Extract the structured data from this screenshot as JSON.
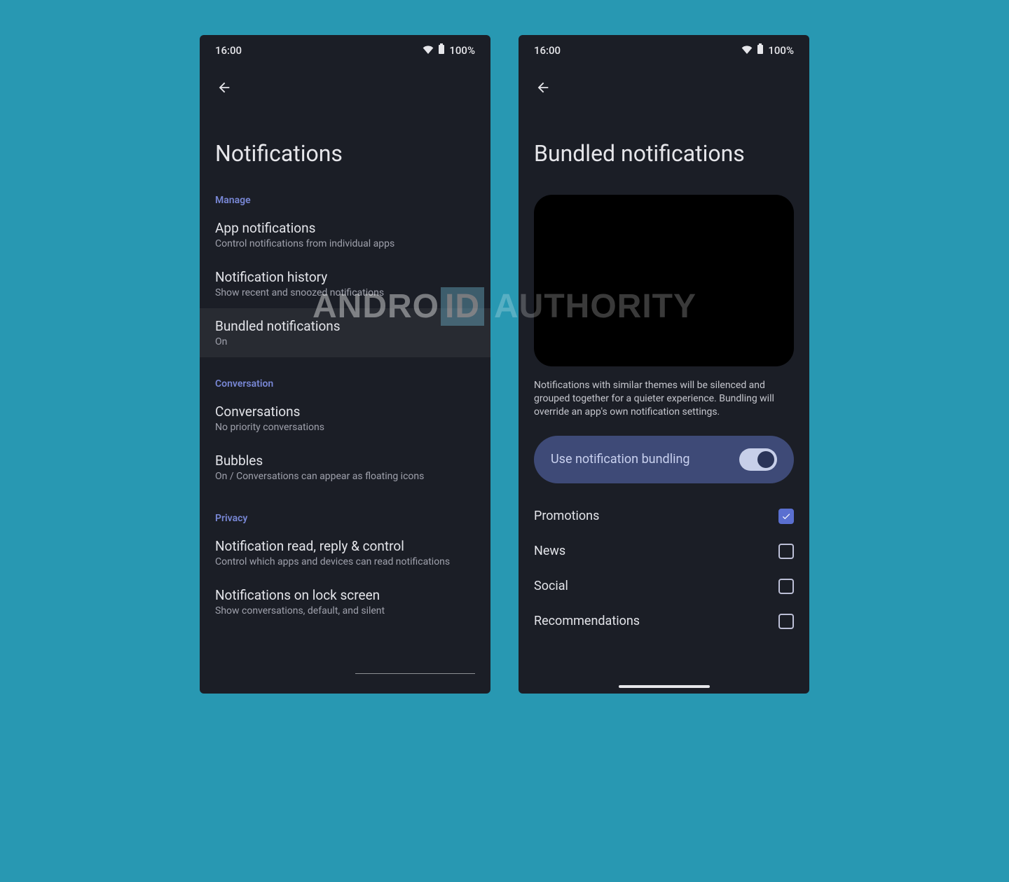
{
  "status": {
    "time": "16:00",
    "battery": "100%"
  },
  "watermark": {
    "a_pre": "ANDRO",
    "a_hl": "ID",
    "b": "AUTHORITY"
  },
  "left": {
    "title": "Notifications",
    "sections": {
      "manage": {
        "header": "Manage",
        "items": [
          {
            "title": "App notifications",
            "sub": "Control notifications from individual apps",
            "key": "app-notifications"
          },
          {
            "title": "Notification history",
            "sub": "Show recent and snoozed notifications",
            "key": "notification-history"
          },
          {
            "title": "Bundled notifications",
            "sub": "On",
            "key": "bundled-notifications",
            "selected": true
          }
        ]
      },
      "conversation": {
        "header": "Conversation",
        "items": [
          {
            "title": "Conversations",
            "sub": "No priority conversations",
            "key": "conversations"
          },
          {
            "title": "Bubbles",
            "sub": "On / Conversations can appear as floating icons",
            "key": "bubbles"
          }
        ]
      },
      "privacy": {
        "header": "Privacy",
        "items": [
          {
            "title": "Notification read, reply & control",
            "sub": "Control which apps and devices can read notifications",
            "key": "notif-read-reply"
          },
          {
            "title": "Notifications on lock screen",
            "sub": "Show conversations, default, and silent",
            "key": "notif-lock-screen"
          }
        ]
      }
    }
  },
  "right": {
    "title": "Bundled notifications",
    "description": "Notifications with similar themes will be silenced and grouped together for a quieter experience. Bundling will override an app's own notification settings.",
    "toggle_label": "Use notification bundling",
    "toggle_on": true,
    "categories": [
      {
        "label": "Promotions",
        "checked": true,
        "key": "promotions"
      },
      {
        "label": "News",
        "checked": false,
        "key": "news"
      },
      {
        "label": "Social",
        "checked": false,
        "key": "social"
      },
      {
        "label": "Recommendations",
        "checked": false,
        "key": "recommendations"
      }
    ]
  }
}
